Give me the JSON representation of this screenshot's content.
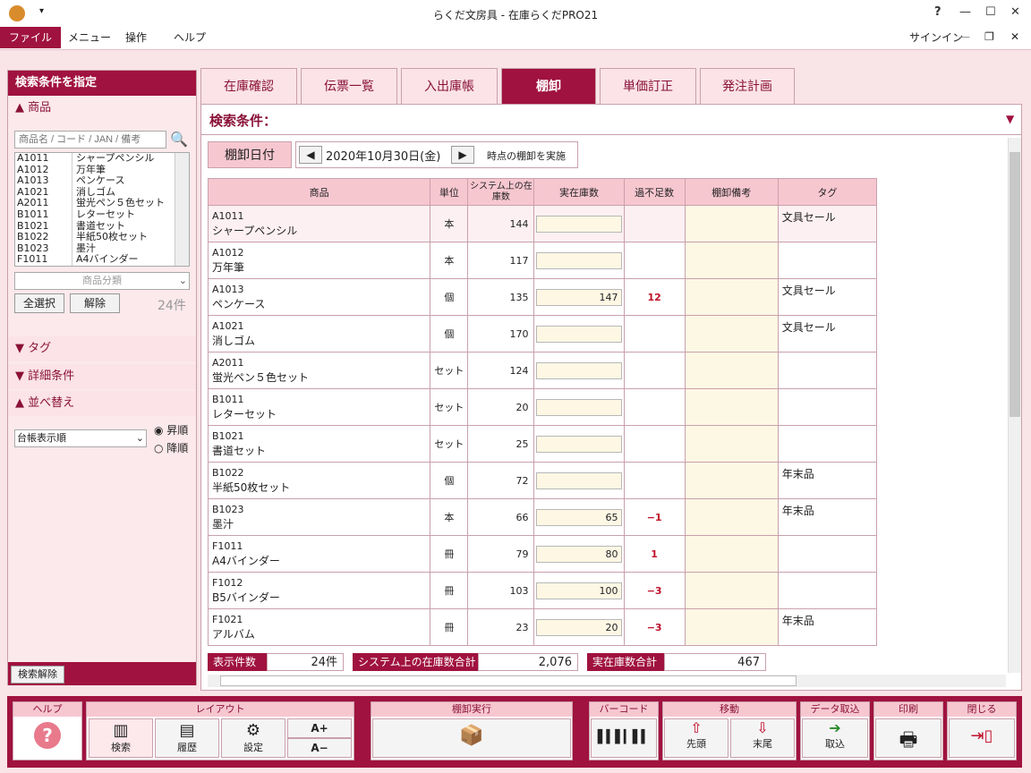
{
  "window": {
    "title": "らくだ文房具 - 在庫らくだPRO21",
    "help": "?",
    "signin": "サインイン"
  },
  "menu": [
    "ファイル",
    "メニュー",
    "操作",
    "ヘルプ"
  ],
  "left": {
    "header": "検索条件を指定",
    "product_section": "商品",
    "search_placeholder": "商品名 / コード / JAN / 備考",
    "product_list": [
      [
        "A1011",
        "シャープペンシル"
      ],
      [
        "A1012",
        "万年筆"
      ],
      [
        "A1013",
        "ペンケース"
      ],
      [
        "A1021",
        "消しゴム"
      ],
      [
        "A2011",
        "蛍光ペン５色セット"
      ],
      [
        "B1011",
        "レターセット"
      ],
      [
        "B1021",
        "書道セット"
      ],
      [
        "B1022",
        "半紙50枚セット"
      ],
      [
        "B1023",
        "墨汁"
      ],
      [
        "F1011",
        "A4バインダー"
      ]
    ],
    "category_placeholder": "商品分類",
    "select_all": "全選択",
    "clear": "解除",
    "count": "24件",
    "tag_section": "タグ",
    "detail_section": "詳細条件",
    "sort_section": "並べ替え",
    "sort_value": "台帳表示順",
    "asc": "昇順",
    "desc": "降順",
    "reset": "検索解除"
  },
  "tabs": [
    "在庫確認",
    "伝票一覧",
    "入出庫帳",
    "棚卸",
    "単価訂正",
    "発注計画"
  ],
  "search_title": "検索条件：",
  "date": {
    "label": "棚卸日付",
    "value": "2020年10月30日(金)",
    "suffix": "時点の棚卸を実施"
  },
  "columns": [
    "商品",
    "単位",
    "システム上の在庫数",
    "実在庫数",
    "過不足数",
    "棚卸備考",
    "タグ"
  ],
  "rows": [
    {
      "code": "A1011",
      "name": "シャープペンシル",
      "unit": "本",
      "sys": "144",
      "actual": "",
      "diff": "",
      "tag": "文具セール"
    },
    {
      "code": "A1012",
      "name": "万年筆",
      "unit": "本",
      "sys": "117",
      "actual": "",
      "diff": "",
      "tag": ""
    },
    {
      "code": "A1013",
      "name": "ペンケース",
      "unit": "個",
      "sys": "135",
      "actual": "147",
      "diff": "12",
      "tag": "文具セール"
    },
    {
      "code": "A1021",
      "name": "消しゴム",
      "unit": "個",
      "sys": "170",
      "actual": "",
      "diff": "",
      "tag": "文具セール"
    },
    {
      "code": "A2011",
      "name": "蛍光ペン５色セット",
      "unit": "セット",
      "sys": "124",
      "actual": "",
      "diff": "",
      "tag": ""
    },
    {
      "code": "B1011",
      "name": "レターセット",
      "unit": "セット",
      "sys": "20",
      "actual": "",
      "diff": "",
      "tag": ""
    },
    {
      "code": "B1021",
      "name": "書道セット",
      "unit": "セット",
      "sys": "25",
      "actual": "",
      "diff": "",
      "tag": ""
    },
    {
      "code": "B1022",
      "name": "半紙50枚セット",
      "unit": "個",
      "sys": "72",
      "actual": "",
      "diff": "",
      "tag": "年末品"
    },
    {
      "code": "B1023",
      "name": "墨汁",
      "unit": "本",
      "sys": "66",
      "actual": "65",
      "diff": "−1",
      "tag": "年末品"
    },
    {
      "code": "F1011",
      "name": "A4バインダー",
      "unit": "冊",
      "sys": "79",
      "actual": "80",
      "diff": "1",
      "tag": ""
    },
    {
      "code": "F1012",
      "name": "B5バインダー",
      "unit": "冊",
      "sys": "103",
      "actual": "100",
      "diff": "−3",
      "tag": ""
    },
    {
      "code": "F1021",
      "name": "アルバム",
      "unit": "冊",
      "sys": "23",
      "actual": "20",
      "diff": "−3",
      "tag": "年末品"
    }
  ],
  "summary": {
    "count_label": "表示件数",
    "count": "24件",
    "sys_label": "システム上の在庫数合計",
    "sys_total": "2,076",
    "act_label": "実在庫数合計",
    "act_total": "467"
  },
  "toolbar": {
    "help": "ヘルプ",
    "layout": "レイアウト",
    "search": "検索",
    "history": "履歴",
    "settings": "設定",
    "font_up": "A+",
    "font_down": "A−",
    "execute": "棚卸実行",
    "barcode": "バーコード",
    "move": "移動",
    "first": "先頭",
    "last": "末尾",
    "import_group": "データ取込",
    "import": "取込",
    "print": "印刷",
    "close": "閉じる"
  }
}
